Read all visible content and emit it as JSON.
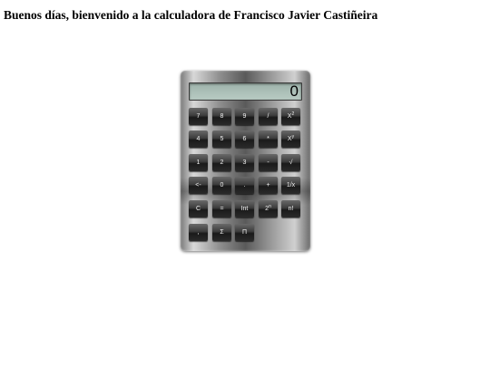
{
  "greeting": "Buenos días, bienvenido a la calculadora de Francisco Javier Castiñeira",
  "display": {
    "value": "0",
    "background_color": "#a9bdb5"
  },
  "keys": {
    "k7": "7",
    "k8": "8",
    "k9": "9",
    "div": "/",
    "x2_base": "X",
    "x2_exp": "2",
    "k4": "4",
    "k5": "5",
    "k6": "6",
    "mul": "*",
    "xy_base": "X",
    "xy_exp": "y",
    "k1": "1",
    "k2": "2",
    "k3": "3",
    "sub": "-",
    "sqrt": "√",
    "back": "<-",
    "k0": "0",
    "dot": ".",
    "add": "+",
    "inv": "1/x",
    "clear": "C",
    "eq": "=",
    "int": "Int",
    "p2_base": "2",
    "p2_exp": "n",
    "fact": "n!",
    "comma": ",",
    "sum": "Σ",
    "prod": "Π"
  },
  "colors": {
    "key_face": "#2a2a2a",
    "key_text": "#f2f2f2",
    "body": "#8f8f8f"
  }
}
